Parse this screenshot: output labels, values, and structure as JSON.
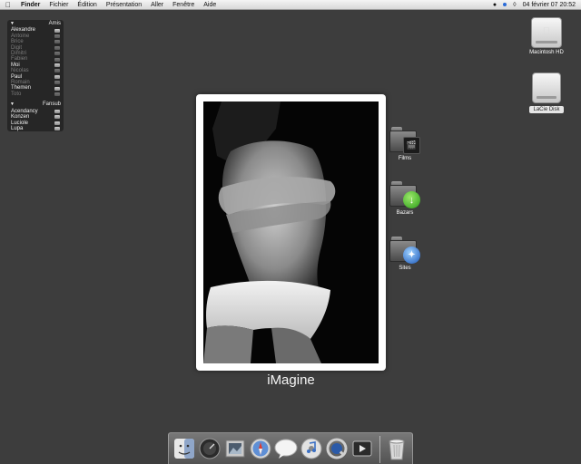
{
  "menubar": {
    "apple_icon": "apple-icon",
    "items": [
      "Finder",
      "Fichier",
      "Édition",
      "Présentation",
      "Aller",
      "Fenêtre",
      "Aide"
    ],
    "clock": "04 février 07  20:52"
  },
  "buddy_list": {
    "groups": [
      {
        "name": "Amis",
        "buddies": [
          {
            "name": "Alexandre",
            "online": true
          },
          {
            "name": "Antoine",
            "online": false
          },
          {
            "name": "Brice",
            "online": false
          },
          {
            "name": "Digit",
            "online": false
          },
          {
            "name": "Dimitri",
            "online": false
          },
          {
            "name": "Fabien",
            "online": false
          },
          {
            "name": "Moi",
            "online": true
          },
          {
            "name": "Nicolas",
            "online": false
          },
          {
            "name": "Paul",
            "online": true
          },
          {
            "name": "Romain",
            "online": false
          },
          {
            "name": "Themen",
            "online": true
          },
          {
            "name": "Toto",
            "online": false
          }
        ]
      },
      {
        "name": "Fansub",
        "buddies": [
          {
            "name": "Acendancy",
            "online": true
          },
          {
            "name": "Konzen",
            "online": true
          },
          {
            "name": "Luciole",
            "online": true
          },
          {
            "name": "Lupa",
            "online": true
          }
        ]
      }
    ]
  },
  "desktop": {
    "drives": [
      {
        "label": "Macintosh HD",
        "icon": "hard-drive-icon"
      },
      {
        "label": "LaCie Disk",
        "icon": "external-drive-icon"
      }
    ],
    "folders": [
      {
        "label": "Films",
        "icon": "clapperboard-icon"
      },
      {
        "label": "Bazars",
        "icon": "download-arrow-icon"
      },
      {
        "label": "Sites",
        "icon": "globe-icon"
      }
    ]
  },
  "photo": {
    "title": "iMagine"
  },
  "dock": {
    "items": [
      {
        "name": "finder",
        "icon": "finder-icon"
      },
      {
        "name": "dashboard",
        "icon": "dashboard-icon"
      },
      {
        "name": "preview",
        "icon": "preview-icon"
      },
      {
        "name": "safari",
        "icon": "safari-compass-icon"
      },
      {
        "name": "ichat",
        "icon": "chat-bubble-icon"
      },
      {
        "name": "itunes",
        "icon": "itunes-cd-icon"
      },
      {
        "name": "quicktime",
        "icon": "quicktime-icon"
      },
      {
        "name": "frontrow",
        "icon": "play-icon"
      }
    ],
    "trash": {
      "name": "trash",
      "icon": "trash-icon"
    }
  }
}
